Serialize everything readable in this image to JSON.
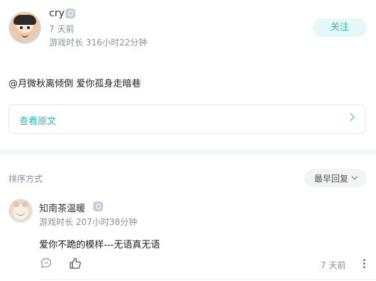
{
  "post": {
    "author": "cry",
    "time": "7 天前",
    "playtime": "游戏时长 316小时22分钟",
    "follow_label": "关注",
    "content": "@月微秋离倾倒  爱你孤身走暗巷",
    "view_original_label": "查看原文"
  },
  "sort": {
    "label": "排序方式",
    "selected": "最早回复"
  },
  "comments": [
    {
      "author": "知南茶温暖",
      "playtime": "游戏时长 207小时38分钟",
      "text": "爱你不跪的模样---无语真无语",
      "time": "7 天前"
    }
  ],
  "icons": {
    "verified": "verified-badge-icon",
    "chevron": "chevron-right-icon",
    "sort": "chevron-down-icon",
    "reply": "comment-bubble-icon",
    "like": "thumbs-up-icon",
    "more": "more-vertical-icon"
  },
  "colors": {
    "accent": "#2bb7b3",
    "follow_bg": "#e6f7f7",
    "muted_text": "#8a8f99"
  }
}
